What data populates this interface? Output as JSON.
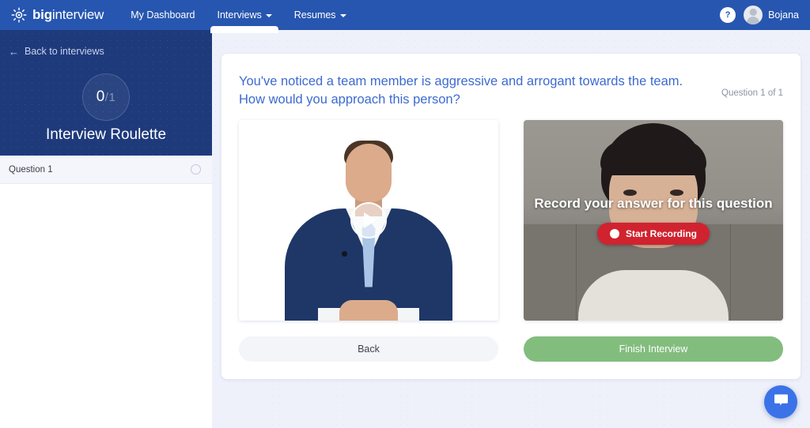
{
  "topbar": {
    "logo": {
      "icon": "sun-icon",
      "bold_text": "big",
      "light_text": "interview"
    },
    "nav": [
      {
        "label": "My Dashboard",
        "has_caret": false,
        "active": false
      },
      {
        "label": "Interviews",
        "has_caret": true,
        "active": true
      },
      {
        "label": "Resumes",
        "has_caret": true,
        "active": false
      }
    ],
    "help_label": "?",
    "user_name": "Bojana"
  },
  "sidebar": {
    "back_label": "Back to interviews",
    "progress": {
      "completed": "0",
      "total": "/1"
    },
    "title": "Interview Roulette",
    "questions": [
      {
        "label": "Question 1",
        "completed": false
      }
    ]
  },
  "main": {
    "question_text": "You've noticed a team member is aggressive and arrogant towards the team. How would you approach this person?",
    "question_count": "Question 1 of 1",
    "sample_video": {
      "play_label": "play-icon"
    },
    "recorder": {
      "title": "Record your answer for this question",
      "button_label": "Start Recording"
    },
    "back_button": "Back",
    "finish_button": "Finish Interview"
  },
  "chat": {
    "icon": "chat-bubble-icon"
  },
  "colors": {
    "topbar_blue": "#2756b0",
    "sidebar_blue": "#1e3a7b",
    "question_blue": "#3d6ad0",
    "record_red": "#d0232f",
    "finish_green": "#82bd7e",
    "chat_blue": "#3b72e8"
  }
}
